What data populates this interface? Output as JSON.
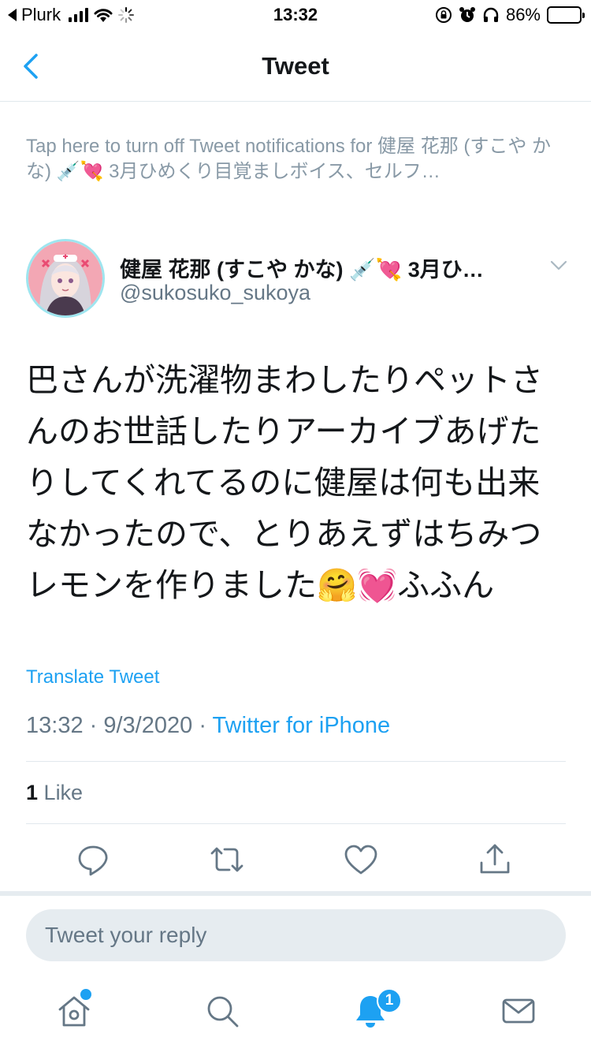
{
  "status_bar": {
    "back_app": "Plurk",
    "time": "13:32",
    "battery": "86%",
    "battery_level": 0.86
  },
  "nav": {
    "title": "Tweet"
  },
  "notification": {
    "text": "Tap here to turn off Tweet notifications for 健屋 花那 (すこや かな) 💉💘 3月ひめくり目覚ましボイス、セルフ…"
  },
  "author": {
    "name": "健屋 花那 (すこや かな) 💉💘 3月ひ…",
    "handle": "@sukosuko_sukoya"
  },
  "tweet": {
    "text": "巴さんが洗濯物まわしたりペットさんのお世話したりアーカイブあげたりしてくれてるのに健屋は何も出来なかったので、とりあえずはちみつレモンを作りました🤗💓ふふん",
    "translate": "Translate Tweet",
    "time": "13:32",
    "date": "9/3/2020",
    "source": "Twitter for iPhone",
    "likes_count": "1",
    "likes_label": "Like"
  },
  "reply": {
    "placeholder": "Tweet your reply"
  },
  "tabbar": {
    "notifications_badge": "1"
  },
  "colors": {
    "accent": "#1da1f2",
    "secondary_text": "#657786",
    "divider": "#e1e8ed"
  }
}
